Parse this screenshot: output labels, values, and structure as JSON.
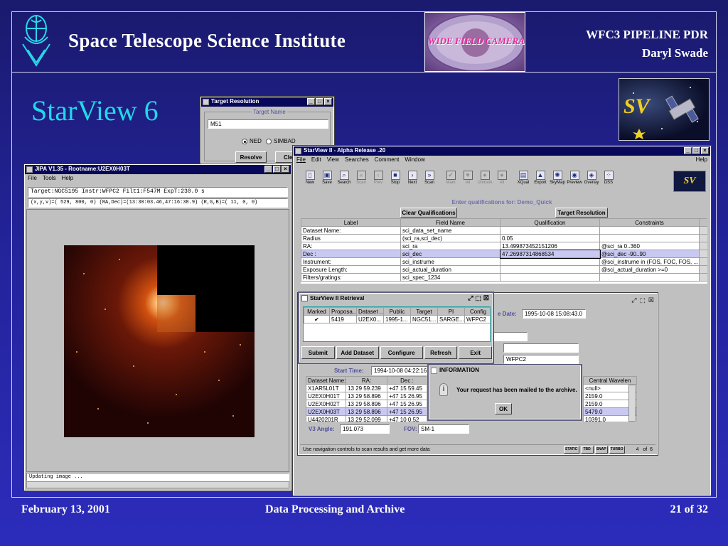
{
  "slide": {
    "institute": "Space Telescope Science Institute",
    "pdr_line1": "WFC3 PIPELINE PDR",
    "pdr_line2": "Daryl Swade",
    "title": "StarView 6",
    "footer_date": "February 13, 2001",
    "footer_topic": "Data Processing and Archive",
    "footer_page": "21 of 32",
    "title_color": "#22d8e8",
    "wfc3_logo_text": "WIDE FIELD CAMERA 3"
  },
  "target_resolution": {
    "title": "Target Resolution",
    "group_label": "Target Name",
    "input_value": "M51",
    "radio_ned": "NED",
    "radio_simbad": "SIMBAD",
    "resolve_label": "Resolve",
    "clear_label": "Clear"
  },
  "jipa": {
    "title": "JIPA V1.35 - Rootname:U2EX0H03T",
    "menu": [
      "File",
      "Tools",
      "Help"
    ],
    "header_line": "Target:NGC5195 Instr:WFPC2 Filt1:F547M ExpT:230.0 s",
    "coords_line": "(x,y,v)=( 529, 800,   0) (RA,Dec)=(13:30:03.46,47:16:38.9) (R,G,B)=( 11,  0,  0)",
    "status": "Updating image ..."
  },
  "starview": {
    "title": "StarView II - Alpha Release .20",
    "menu": [
      "File",
      "Edit",
      "View",
      "Searches",
      "Comment",
      "Window"
    ],
    "help": "Help",
    "toolbar": [
      {
        "label": "New",
        "icon": "new-icon",
        "glyph": "▯",
        "enabled": true
      },
      {
        "label": "Save",
        "icon": "save-icon",
        "glyph": "▣",
        "enabled": true
      },
      {
        "label": "Search",
        "icon": "search-icon",
        "glyph": "⌕",
        "enabled": true
      },
      {
        "label": "Scan",
        "icon": "scan-back-icon",
        "glyph": "«",
        "enabled": false
      },
      {
        "label": "Prev",
        "icon": "prev-icon",
        "glyph": "‹",
        "enabled": false
      },
      {
        "label": "Stop",
        "icon": "stop-icon",
        "glyph": "■",
        "enabled": true
      },
      {
        "label": "Next",
        "icon": "next-icon",
        "glyph": "›",
        "enabled": true
      },
      {
        "label": "Scan",
        "icon": "scan-forward-icon",
        "glyph": "»",
        "enabled": true
      },
      {
        "label": "Mark",
        "icon": "mark-icon",
        "glyph": "✔",
        "enabled": false
      },
      {
        "label": "All",
        "icon": "mark-all-icon",
        "glyph": "♥",
        "enabled": false
      },
      {
        "label": "Unmark",
        "icon": "unmark-icon",
        "glyph": "●",
        "enabled": false
      },
      {
        "label": "All",
        "icon": "unmark-all-icon",
        "glyph": "●",
        "enabled": false
      },
      {
        "label": "XQual",
        "icon": "xqual-icon",
        "glyph": "▤",
        "enabled": true
      },
      {
        "label": "Export",
        "icon": "export-icon",
        "glyph": "▲",
        "enabled": true
      },
      {
        "label": "SkyMap",
        "icon": "skymap-icon",
        "glyph": "✺",
        "enabled": true
      },
      {
        "label": "Preview",
        "icon": "preview-icon",
        "glyph": "◉",
        "enabled": true
      },
      {
        "label": "Overlay",
        "icon": "overlay-icon",
        "glyph": "◈",
        "enabled": true
      },
      {
        "label": "DSS",
        "icon": "dss-icon",
        "glyph": "⁘",
        "enabled": true
      }
    ],
    "sv_badge": "SV",
    "qual_heading": "Enter qualifications for: Demo_Quick",
    "clear_qual": "Clear Qualifications",
    "target_res": "Target Resolution",
    "columns": [
      "Label",
      "Field Name",
      "Qualification",
      "Constraints"
    ],
    "rows": [
      [
        "Dataset Name:",
        "sci_data_set_name",
        "",
        ""
      ],
      [
        "Radius",
        "(sci_ra,sci_dec)",
        "0.05",
        ""
      ],
      [
        "RA:",
        "sci_ra",
        "13.49987345215120​6",
        "@sci_ra 0..360"
      ],
      [
        "Dec :",
        "sci_dec",
        "47.26987314868534",
        "@sci_dec -90..90"
      ],
      [
        "Instrument:",
        "sci_instrume",
        "",
        "@sci_instrume in (FOS, FOC, FOS, ..."
      ],
      [
        "Exposure Length:",
        "sci_actual_duration",
        "",
        "@sci_actual_duration >=0"
      ],
      [
        "Filters/gratings:",
        "sci_spec_1234",
        "",
        ""
      ]
    ]
  },
  "results": {
    "date_label": "e Date:",
    "date_value": "1995-10-08 15:08:43.0",
    "instr_value": "WFPC2",
    "start_label": "Start Time:",
    "start_value": "1994-10-08 04:22:16.",
    "columns": [
      "Dataset Name:",
      "RA:",
      "Dec :"
    ],
    "rows": [
      [
        "X1AR5L01T",
        "13 29 59.239",
        "+47 15 59.45"
      ],
      [
        "U2EX0H01T",
        "13 29 58.896",
        "+47 15 26.95"
      ],
      [
        "U2EX0H02T",
        "13 29 58.896",
        "+47 15 26.95"
      ],
      [
        "U2EX0H03T",
        "13 29 58.896",
        "+47 15 26.95"
      ],
      [
        "U4420201R",
        "13 29 52.099",
        "+47 10 0.52"
      ]
    ],
    "wave_header": "Central Wavelen",
    "wave_values": [
      "<null>",
      "2159.0",
      "2159.0",
      "5479.0",
      "10391.0"
    ],
    "v3_label": "V3 Angle:",
    "v3_value": "191.073",
    "fov_label": "FOV:",
    "fov_value": "SM-1",
    "status": "Use navigation controls to scan results and get more data",
    "status_btns": [
      "STATIC",
      "TBD",
      "SNAP",
      "TURBO"
    ],
    "page": "4   of  6"
  },
  "retrieval": {
    "title": "StarView II Retrieval",
    "columns": [
      "Marked",
      "Proposa...",
      "Dataset ...",
      "Public",
      "Target",
      "PI",
      "Config"
    ],
    "row": [
      "✔",
      "5419",
      "U2EX0...",
      "1995-1...",
      "NGC51...",
      "SARGE...",
      "WFPC2"
    ],
    "buttons": [
      "Submit",
      "Add Dataset",
      "Configure",
      "Refresh",
      "Exit"
    ]
  },
  "information": {
    "title": "INFORMATION",
    "message": "Your request has been mailed to the archive.",
    "ok": "OK"
  }
}
